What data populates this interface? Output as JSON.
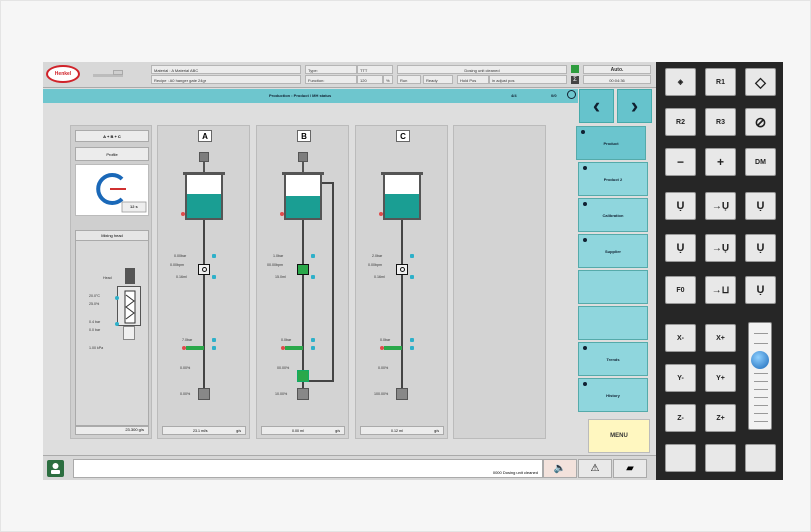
{
  "header": {
    "logo": "Henkel",
    "material_label": "Material : A  Material ABC",
    "recipe_label": "Recipe : A0 hanger gate 24gr",
    "type_label": "Type:",
    "type_value": "TTT",
    "function_label": "Function:",
    "function_value": "120",
    "function_unit": "%",
    "run": "Run",
    "ready": "Ready",
    "message_top": "Dosing unit cleaned",
    "hold_pos": "Hold Pos",
    "hold_value": "in adjust pos",
    "mode": "Auto.",
    "time": "00:04:36"
  },
  "titlebar": {
    "title": "Production : Product / MH status",
    "step": "4/4",
    "count": "0/0"
  },
  "left_panel": {
    "mix": "A + B + C",
    "profile_label": "Profile",
    "gauge_value": "12 s",
    "mixing_head_label": "Mixing head",
    "head_label": "Head",
    "t1": "20.0°C",
    "t2": "25.0%",
    "p1": "0.4 bar",
    "p2": "0.0 bar",
    "p3": "1.00 kPa",
    "footer": "23.300 g/s"
  },
  "columns": [
    {
      "letter": "A",
      "fill_pct": 55,
      "l1": "0.00bar",
      "l2": "0.00bpm",
      "l3": "0.16ml",
      "l4": "7.0bar",
      "l5": "0.00%",
      "l6": "0.00%",
      "footer_value": "23.1 ml/s",
      "footer_unit": "g/s"
    },
    {
      "letter": "B",
      "fill_pct": 50,
      "l1": "1.0bar",
      "l2": "00.00bpm",
      "l3": "15.0ml",
      "l4": "0.0bar",
      "l5": "00.00%",
      "l6": "10.00%",
      "footer_value": "0.00 ml",
      "footer_unit": "g/s"
    },
    {
      "letter": "C",
      "fill_pct": 55,
      "l1": "2.0bar",
      "l2": "0.00bpm",
      "l3": "0.16ml",
      "l4": "0.0bar",
      "l5": "0.00%",
      "l6": "100.00%",
      "footer_value": "0.12 ml",
      "footer_unit": "g/s"
    }
  ],
  "tabs": [
    {
      "label": "Product"
    },
    {
      "label": "Product 2"
    },
    {
      "label": "Calibration"
    },
    {
      "label": "Supplier"
    },
    {
      "label": ""
    },
    {
      "label": ""
    },
    {
      "label": "Trends"
    },
    {
      "label": "History"
    }
  ],
  "menu_label": "MENU",
  "status": {
    "message": "0000 Dosing unit cleaned"
  },
  "keypad": {
    "row1": [
      "",
      "R1",
      ""
    ],
    "row2": [
      "R2",
      "R3",
      ""
    ],
    "row3": [
      "−",
      "+",
      "DM"
    ],
    "row6": [
      "F0",
      "",
      ""
    ],
    "row7": [
      "X-",
      "X+"
    ],
    "row8": [
      "Y-",
      "Y+"
    ],
    "row9": [
      "Z-",
      "Z+"
    ]
  },
  "colors": {
    "teal": "#1a9e93",
    "tab": "#8fd6dd",
    "menu": "#fff7c0",
    "keypad_bg": "#262626"
  }
}
